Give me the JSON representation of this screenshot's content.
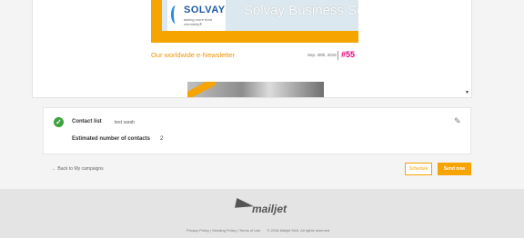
{
  "preview": {
    "logo_text": "SOLVAY",
    "logo_tagline": "asking more from chemistry®",
    "banner_title": "Solvay Business Services",
    "newsletter_title": "Our worldwide e-Newsletter",
    "newsletter_date": "Sep. 30th, 2015",
    "newsletter_number": "#55",
    "photo_ribbon": "",
    "scroll_arrow": "▼"
  },
  "contact": {
    "list_label": "Contact list",
    "list_value": "test sarah",
    "estimated_label": "Estimated number of contacts",
    "estimated_value": "2",
    "check_icon": "check-icon",
    "edit_icon": "pencil-icon"
  },
  "actions": {
    "back_label": "← Back to My campaigns",
    "schedule_label": "Schedule",
    "send_label": "Send now"
  },
  "footer": {
    "brand": "mailjet",
    "privacy": "Privacy Policy",
    "sending": "Sending Policy",
    "terms": "Terms of Use",
    "copyright": "© 2016 Mailjet SAS. All rights reserved"
  },
  "colors": {
    "accent": "#f6a400",
    "success": "#3ea33e",
    "background": "#f4f4f4"
  }
}
